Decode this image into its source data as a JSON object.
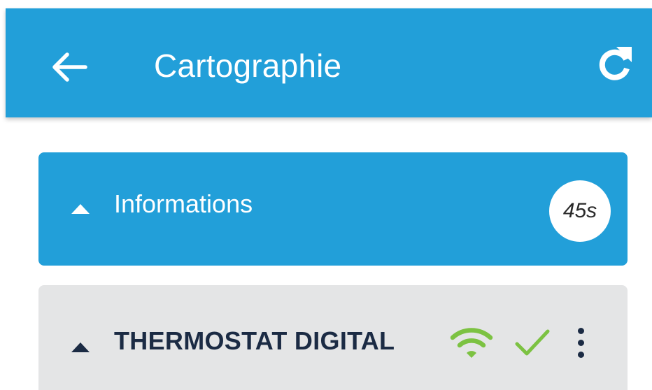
{
  "app_bar": {
    "title": "Cartographie",
    "back_icon": "arrow-left-icon",
    "refresh_icon": "refresh-icon",
    "background": "#229fd9"
  },
  "panels": [
    {
      "title": "Informations",
      "expanded_icon": "caret-up-icon",
      "badge": "45s",
      "background": "#229fd9"
    },
    {
      "title": "THERMOSTAT DIGITAL",
      "expanded_icon": "caret-up-icon",
      "status_icons": [
        "wifi-icon",
        "check-icon",
        "more-vertical-icon"
      ],
      "status_color": "#7cc242",
      "background": "#e4e5e6"
    }
  ]
}
